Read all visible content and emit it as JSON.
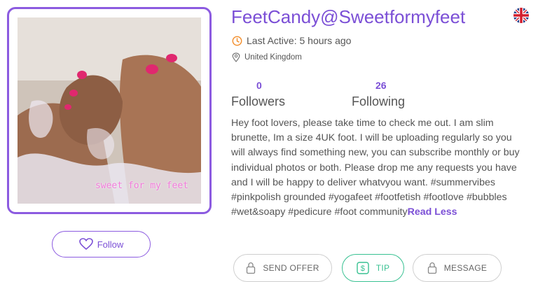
{
  "profile": {
    "name": "FeetCandy@Sweetformyfeet",
    "flag_icon": "uk-flag-icon",
    "last_active": "Last Active: 5 hours ago",
    "location": "United Kingdom",
    "photo_watermark": "sweet for my feet"
  },
  "stats": {
    "followers_count": "0",
    "followers_label": "Followers",
    "following_count": "26",
    "following_label": "Following"
  },
  "bio": {
    "text": "Hey foot lovers, please take time to check me out. I am slim brunette, Im a size 4UK foot. I will be uploading regularly so you will always find something new, you can subscribe monthly or buy individual photos or both. Please drop me any requests you have and I will be happy to deliver whatvyou want. #summervibes #pinkpolish grounded #yogafeet #footfetish #footlove #bubbles #wet&soapy #pedicure #foot community",
    "toggle_label": "Read Less"
  },
  "actions": {
    "follow_label": "Follow",
    "send_offer_label": "SEND OFFER",
    "tip_label": "TIP",
    "message_label": "MESSAGE"
  },
  "colors": {
    "accent": "#7b4fd6",
    "tip": "#38c192",
    "location_dot": "#f28c28"
  }
}
